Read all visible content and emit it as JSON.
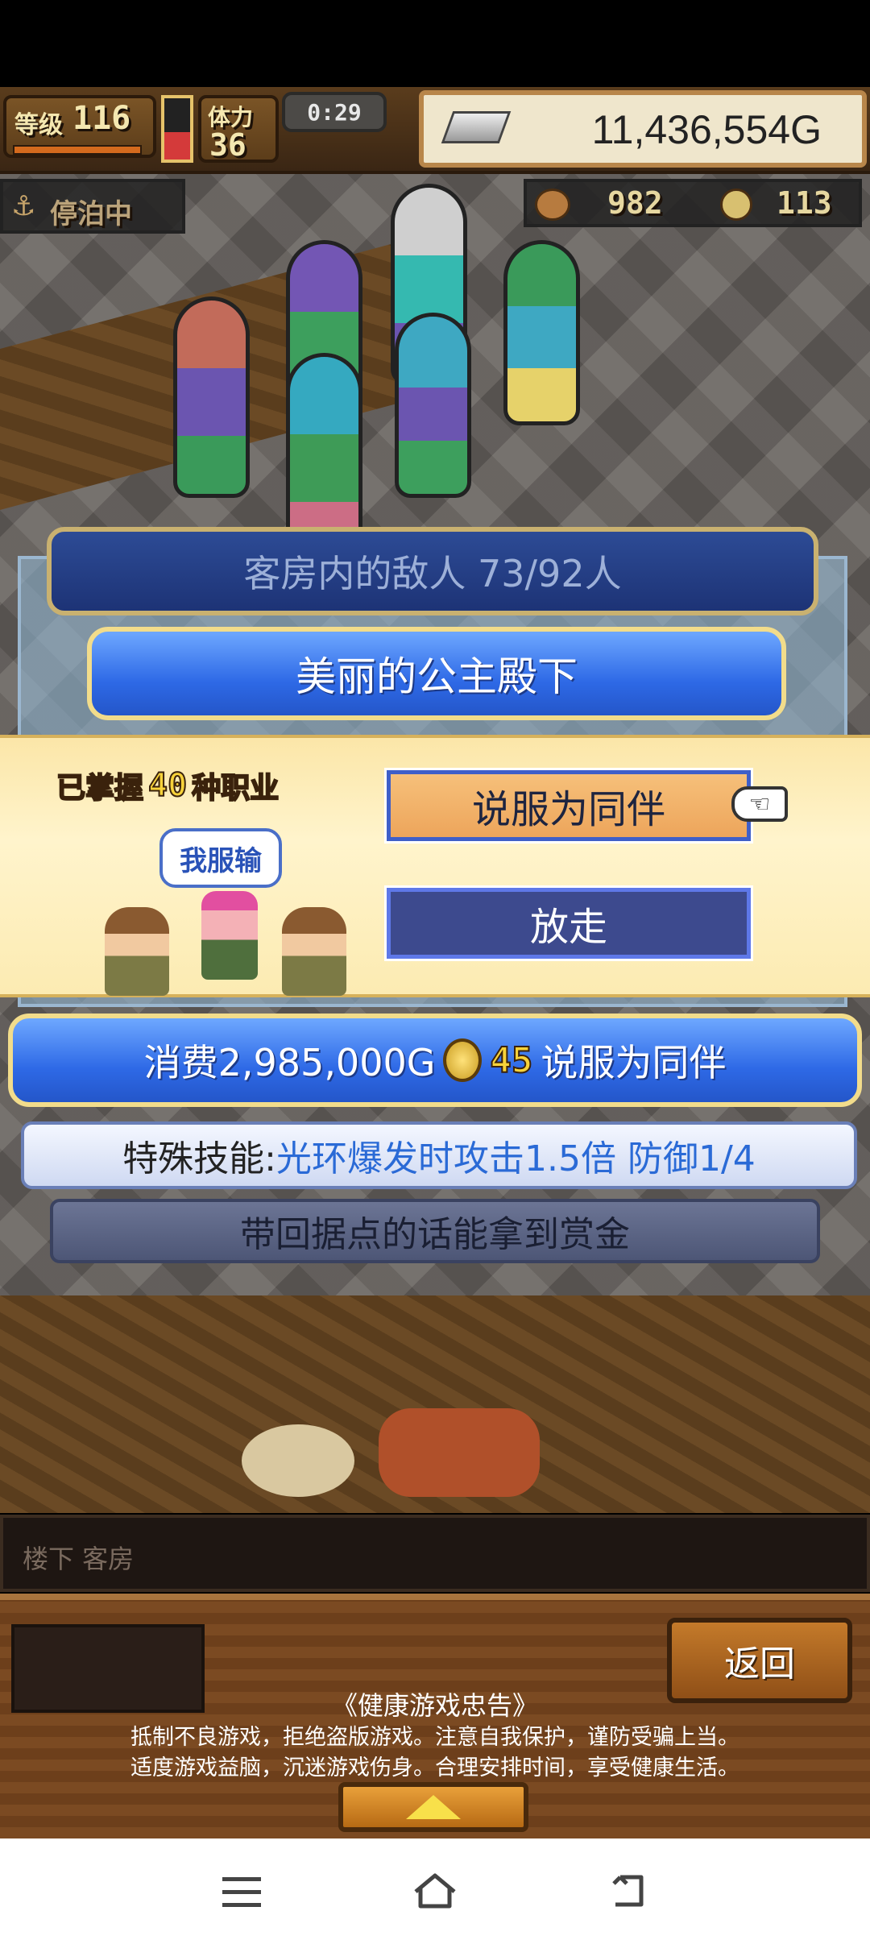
{
  "hud": {
    "level_label": "等级",
    "level_value": "116",
    "stamina_label": "体力",
    "stamina_value": "36",
    "timer": "0:29",
    "money": "11,436,554G",
    "docked_status": "停泊中",
    "resource1_value": "982",
    "resource2_value": "113"
  },
  "dialog": {
    "enemy_count_label": "客房内的敌人  73/92人",
    "character_name": "美丽的公主殿下",
    "jobs_mastered": "已掌握",
    "jobs_count": "40",
    "jobs_suffix": "种职业",
    "speech_bubble": "我服输",
    "persuade_button": "说服为同伴",
    "release_button": "放走",
    "cost_prefix": "消费2,985,000G",
    "cost_coins": "45",
    "cost_suffix": "说服为同伴",
    "skill_label": "特殊技能:",
    "skill_text": "光环爆发时攻击1.5倍 防御1/4",
    "bounty_text": "带回据点的话能拿到赏金"
  },
  "location": {
    "breadcrumb": "楼下 客房"
  },
  "bottom": {
    "return_button": "返回",
    "health_title": "《健康游戏忠告》",
    "health_line1": "抵制不良游戏，拒绝盗版游戏。注意自我保护，谨防受骗上当。",
    "health_line2": "适度游戏益脑，沉迷游戏伤身。合理安排时间，享受健康生活。"
  },
  "nav": {
    "menu_icon": "menu-icon",
    "home_icon": "home-icon",
    "back_icon": "back-icon"
  },
  "colors": {
    "banner_blue": "#2e69e6",
    "orange_button": "#f6c07a",
    "navy_button": "#3d4a8e",
    "panel_yellow": "#fff4cc"
  }
}
